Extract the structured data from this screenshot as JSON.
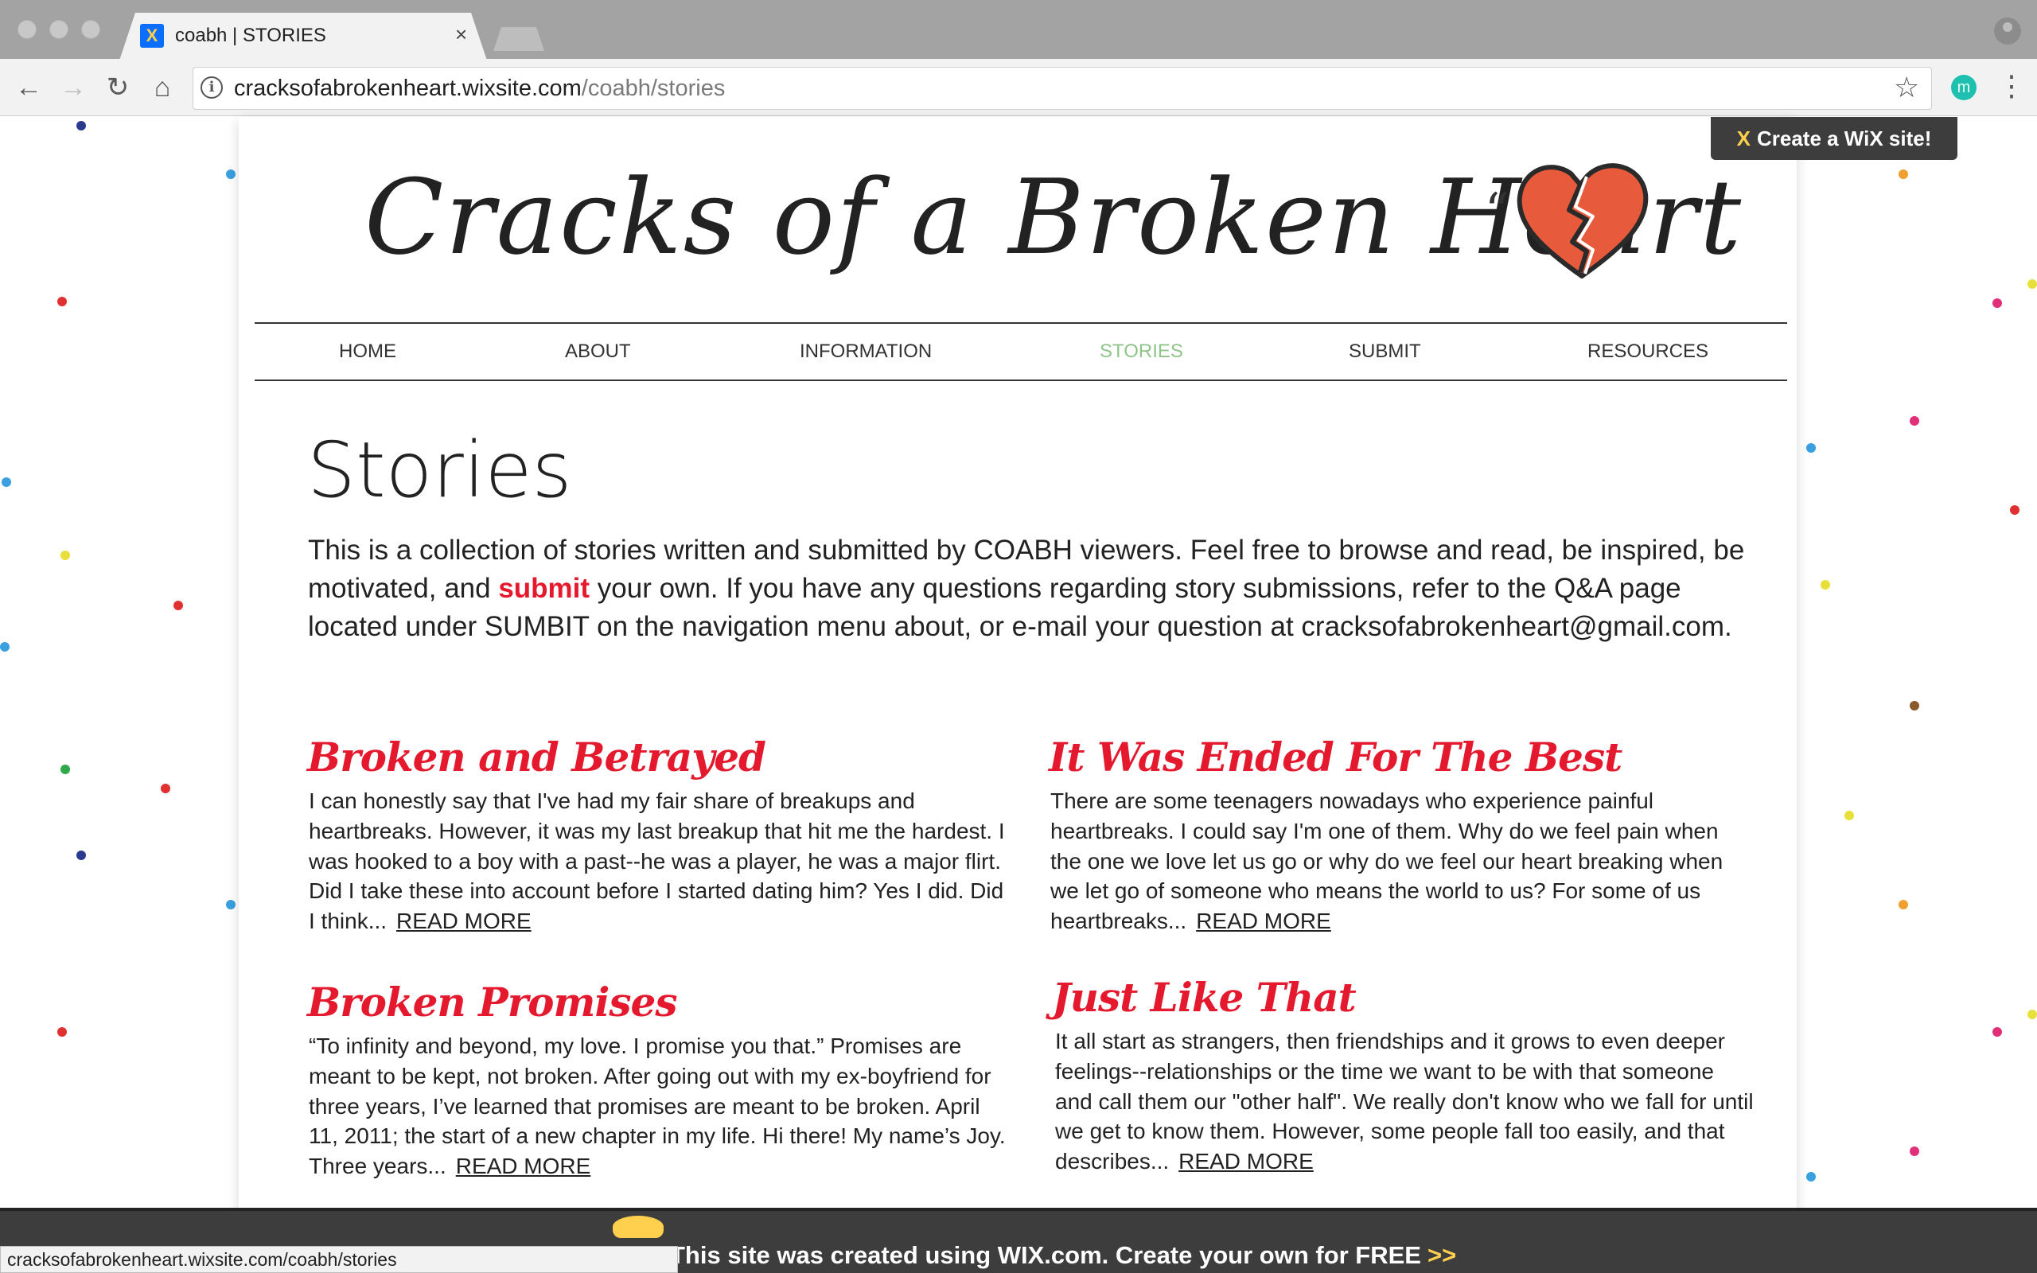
{
  "browser": {
    "tab_title": "coabh | STORIES",
    "tab_close": "×",
    "favicon": "wix-favicon",
    "url_host": "cracksofabrokenheart.wixsite.com",
    "url_path": "/coabh/stories",
    "back_icon": "←",
    "forward_icon": "→",
    "reload_icon": "↻",
    "home_icon": "⌂",
    "info_icon": "i",
    "star_icon": "☆",
    "extension_letter": "m",
    "menu_icon": "⋮"
  },
  "site": {
    "title": "Cracks of a Broken Heart",
    "quote_mark": "“",
    "heart": "broken-heart-icon",
    "heart_color": "#e85a3c",
    "wix_badge": "Create a WiX site!",
    "wix_badge_icon": "X"
  },
  "nav": {
    "items": [
      {
        "label": "HOME"
      },
      {
        "label": "ABOUT"
      },
      {
        "label": "INFORMATION"
      },
      {
        "label": "STORIES",
        "active": true
      },
      {
        "label": "SUBMIT"
      },
      {
        "label": "RESOURCES"
      }
    ],
    "active_color": "#8fc48a"
  },
  "main": {
    "heading": "Stories",
    "intro_part1": "This is a collection of stories written and submitted by COABH viewers. Feel free to browse and read, be inspired, be motivated, and ",
    "intro_link": "submit",
    "intro_part2": " your own. If you have any questions regarding story submissions, refer to the Q&A page located under SUMBIT on the navigation menu about, or e-mail your question at cracksofabrokenheart@gmail.com.",
    "accent_color": "#e5192e",
    "stories": [
      {
        "title": "Broken and Betrayed",
        "body": "I can honestly say that I've had my fair share of breakups and heartbreaks. However, it was my last breakup that hit me the hardest. I was hooked to a boy with a past--he was a player, he was a major flirt. Did I take these into account before I started dating him? Yes I did. Did I think...",
        "read_more": "READ MORE"
      },
      {
        "title": "It Was Ended For The Best",
        "body": "There are some teenagers nowadays who experience painful heartbreaks. I could say I'm one of them. Why do we feel pain when the one we love let us go or why do we feel our heart breaking when we let go of someone who means the world to us? For some of us heartbreaks...",
        "read_more": "READ MORE"
      },
      {
        "title": "Broken Promises",
        "body": "“To infinity and beyond, my love. I promise you that.” Promises are meant to be kept, not broken. After going out with my ex-boyfriend for three years, I’ve learned that promises are meant to be broken. April 11, 2011; the start of a new chapter in my life. Hi there! My name’s Joy. Three years...",
        "read_more": "READ MORE"
      },
      {
        "title": "Just Like That",
        "body": "It all start as strangers, then friendships and it grows to even deeper feelings--relationships or the time we want to be with that someone and call them our \"other half\". We really don't know who we fall for until we get to know them. However, some people fall too easily, and that describes...",
        "read_more": "READ MORE"
      }
    ]
  },
  "footer": {
    "text": "This site was created using WIX.com. Create your own for FREE",
    "arrow": ">>",
    "status_url": "cracksofabrokenheart.wixsite.com/coabh/stories"
  }
}
